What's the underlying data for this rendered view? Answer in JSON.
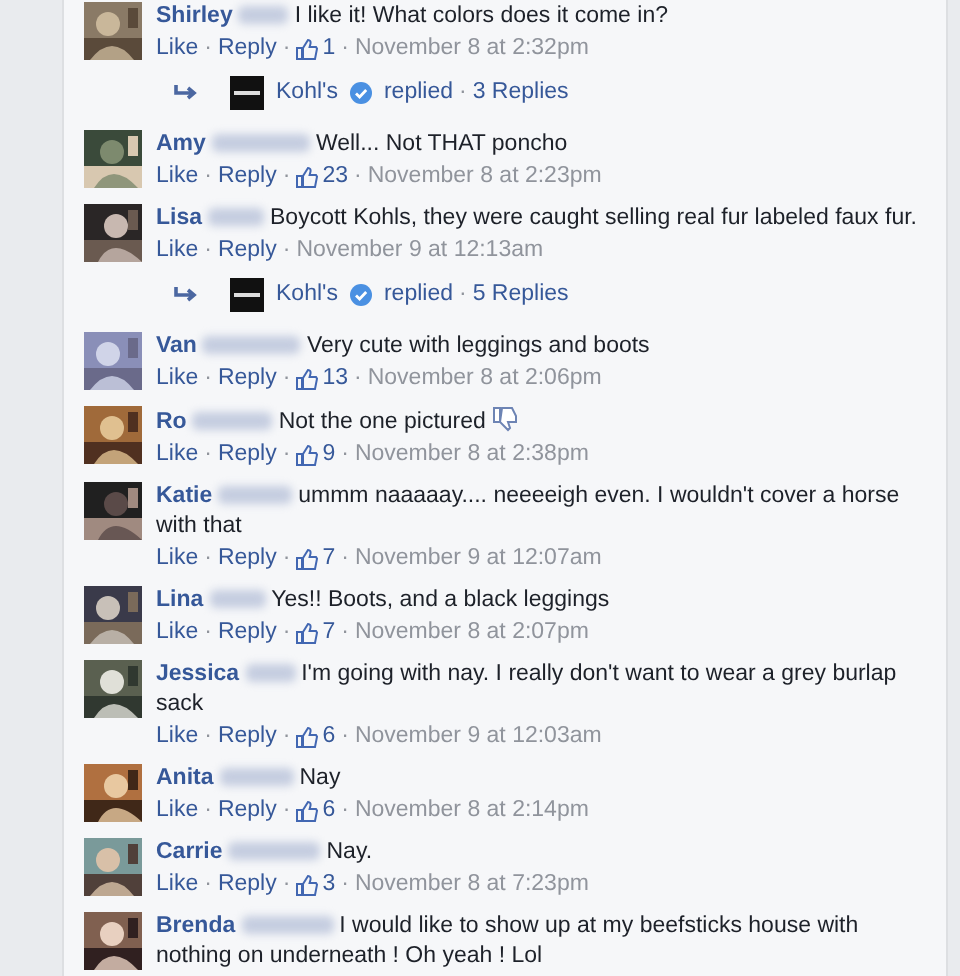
{
  "separator": "·",
  "thread": [
    {
      "kind": "comment",
      "name": "Shirley",
      "text": "I like it! What colors does it come in?",
      "actions": [
        "Like",
        "Reply"
      ],
      "likes": "1",
      "time": "November 8 at 2:32pm"
    },
    {
      "kind": "replies",
      "page": "Kohl's",
      "verified": true,
      "verb": "replied",
      "count": "3 Replies"
    },
    {
      "kind": "comment",
      "name": "Amy",
      "text": "Well... Not THAT poncho",
      "actions": [
        "Like",
        "Reply"
      ],
      "likes": "23",
      "time": "November 8 at 2:23pm"
    },
    {
      "kind": "comment",
      "name": "Lisa",
      "text": "Boycott Kohls, they were caught selling real fur labeled faux fur.",
      "actions": [
        "Like",
        "Reply"
      ],
      "time": "November 9 at 12:13am"
    },
    {
      "kind": "replies",
      "page": "Kohl's",
      "verified": true,
      "verb": "replied",
      "count": "5 Replies"
    },
    {
      "kind": "comment",
      "name": "Van",
      "text": "Very cute with leggings and boots",
      "actions": [
        "Like",
        "Reply"
      ],
      "likes": "13",
      "time": "November 8 at 2:06pm"
    },
    {
      "kind": "comment",
      "name": "Ro",
      "text": "Not the one pictured",
      "thumbs_down": true,
      "actions": [
        "Like",
        "Reply"
      ],
      "likes": "9",
      "time": "November 8 at 2:38pm"
    },
    {
      "kind": "comment",
      "name": "Katie",
      "text": "ummm naaaaay.... neeeeigh even. I wouldn't cover a horse with that",
      "actions": [
        "Like",
        "Reply"
      ],
      "likes": "7",
      "time": "November 9 at 12:07am"
    },
    {
      "kind": "comment",
      "name": "Lina",
      "text": "Yes!! Boots, and a black leggings",
      "actions": [
        "Like",
        "Reply"
      ],
      "likes": "7",
      "time": "November 8 at 2:07pm"
    },
    {
      "kind": "comment",
      "name": "Jessica",
      "text": "I'm going with nay. I really don't want to wear a grey burlap sack",
      "actions": [
        "Like",
        "Reply"
      ],
      "likes": "6",
      "time": "November 9 at 12:03am"
    },
    {
      "kind": "comment",
      "name": "Anita",
      "text": "Nay",
      "actions": [
        "Like",
        "Reply"
      ],
      "likes": "6",
      "time": "November 8 at 2:14pm"
    },
    {
      "kind": "comment",
      "name": "Carrie",
      "text": "Nay.",
      "actions": [
        "Like",
        "Reply"
      ],
      "likes": "3",
      "time": "November 8 at 7:23pm"
    },
    {
      "kind": "comment",
      "name": "Brenda",
      "text": "I would like to show up at my beefsticks house with nothing on underneath ! Oh yeah ! Lol"
    }
  ]
}
